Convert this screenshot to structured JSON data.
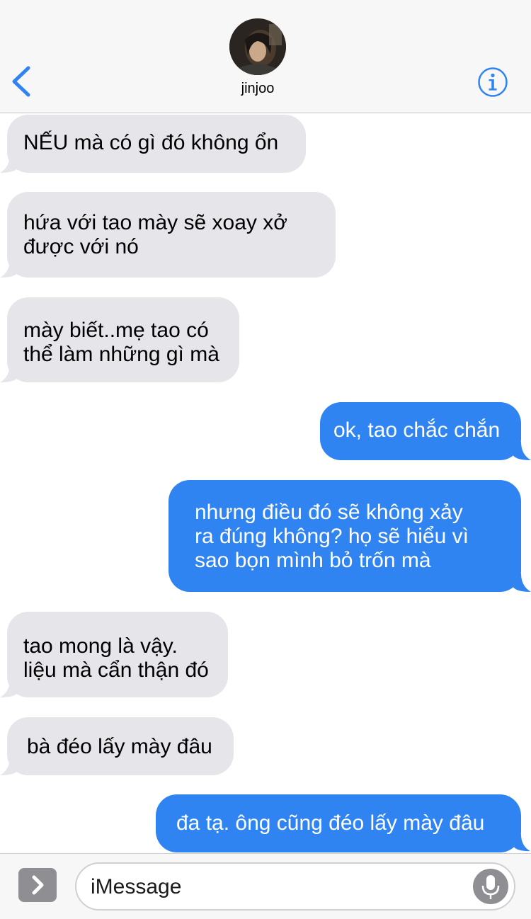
{
  "header": {
    "contact_name": "jinjoo",
    "back_icon": "chevron-left-icon",
    "info_icon": "info-icon",
    "accent_color": "#2f84f2"
  },
  "messages": [
    {
      "direction": "incoming",
      "text": "NẾU mà có gì đó không ổn"
    },
    {
      "direction": "incoming",
      "text": "hứa với tao mày sẽ xoay xở\nđược với nó"
    },
    {
      "direction": "incoming",
      "text": "mày biết..mẹ tao có\nthể làm những gì mà"
    },
    {
      "direction": "outgoing",
      "text": "ok, tao chắc chắn"
    },
    {
      "direction": "outgoing",
      "text": "nhưng điều đó sẽ không xảy\nra đúng không? họ sẽ hiểu vì\nsao bọn mình bỏ trốn mà"
    },
    {
      "direction": "incoming",
      "text": "tao mong là vậy.\nliệu mà cẩn thận đó"
    },
    {
      "direction": "incoming",
      "text": "bà đéo lấy mày đâu"
    },
    {
      "direction": "outgoing",
      "text": "đa tạ. ông cũng đéo lấy mày đâu"
    }
  ],
  "composer": {
    "placeholder": "iMessage",
    "expand_icon": "chevron-right-icon",
    "mic_icon": "microphone-icon"
  },
  "colors": {
    "incoming_bubble": "#e5e5ea",
    "outgoing_bubble": "#2f84f2"
  }
}
